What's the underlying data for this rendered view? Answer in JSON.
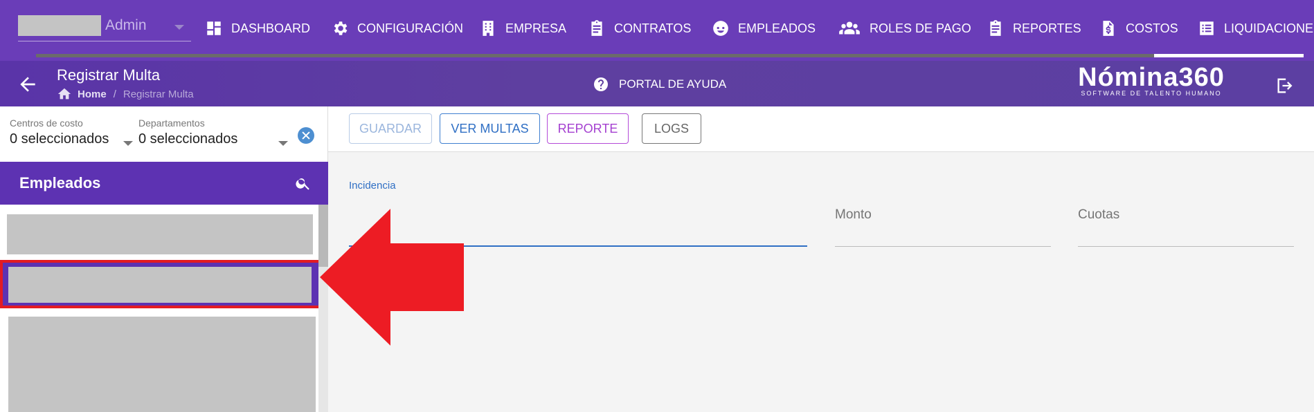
{
  "app": {
    "user_name": "Admin"
  },
  "nav": {
    "items": [
      {
        "label": "DASHBOARD",
        "icon": "dashboard-icon"
      },
      {
        "label": "CONFIGURACIÓN",
        "icon": "gear-icon"
      },
      {
        "label": "EMPRESA",
        "icon": "building-icon"
      },
      {
        "label": "CONTRATOS",
        "icon": "clipboard-icon"
      },
      {
        "label": "EMPLEADOS",
        "icon": "face-icon"
      },
      {
        "label": "ROLES DE PAGO",
        "icon": "people-icon"
      },
      {
        "label": "REPORTES",
        "icon": "clipboard-icon"
      },
      {
        "label": "COSTOS",
        "icon": "invoice-dollar-icon"
      },
      {
        "label": "LIQUIDACIONE",
        "icon": "list-icon"
      }
    ]
  },
  "header": {
    "title": "Registrar Multa",
    "breadcrumb_home": "Home",
    "breadcrumb_sep": "/",
    "breadcrumb_current": "Registrar Multa",
    "help_label": "PORTAL DE AYUDA",
    "logo_main": "Nómina360",
    "logo_sub": "SOFTWARE DE TALENTO HUMANO"
  },
  "filters": {
    "centros_label": "Centros de costo",
    "centros_value": "0 seleccionados",
    "departamentos_label": "Departamentos",
    "departamentos_value": "0 seleccionados"
  },
  "employees": {
    "title": "Empleados"
  },
  "toolbar": {
    "guardar": "GUARDAR",
    "ver_multas": "VER MULTAS",
    "reporte": "REPORTE",
    "logs": "LOGS"
  },
  "form": {
    "incidencia_label": "Incidencia",
    "monto_placeholder": "Monto",
    "cuotas_placeholder": "Cuotas"
  },
  "colors": {
    "nav_bg": "#6a3db8",
    "accent_purple": "#5d32b2",
    "link_blue": "#2f6fc4",
    "annotation_red": "#e31b23"
  }
}
